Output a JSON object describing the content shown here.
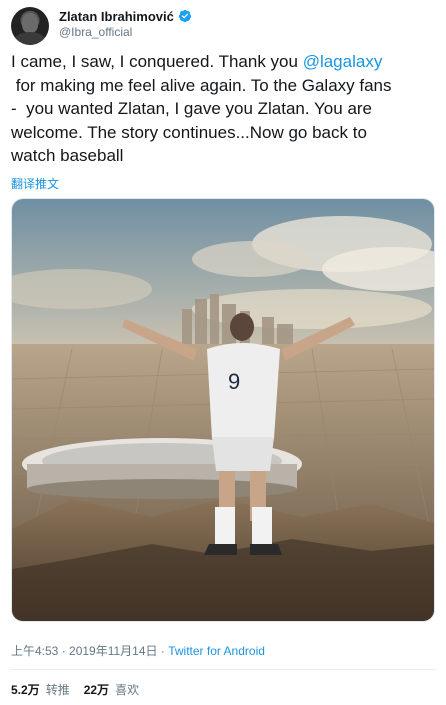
{
  "author": {
    "display_name": "Zlatan Ibrahimović",
    "handle": "@Ibra_official"
  },
  "tweet": {
    "text_before_mention": "I came, I saw, I conquered. Thank you ",
    "mention": "@lagalaxy",
    "text_after_mention": "\n for making me feel alive again. To the Galaxy fans\n-  you wanted Zlatan, I gave you Zlatan. You are\nwelcome. The story continues...Now go back to\nwatch baseball"
  },
  "translate_label": "翻译推文",
  "meta": {
    "timestamp": "上午4:53 · 2019年11月14日",
    "separator": " · ",
    "source": "Twitter for Android"
  },
  "stats": {
    "retweets_count": "5.2万",
    "retweets_label": "转推",
    "likes_count": "22万",
    "likes_label": "喜欢"
  },
  "colors": {
    "link": "#1b95e0",
    "secondary_text": "#657786",
    "verified_badge": "#1da1f2"
  },
  "icons": [
    "verified-badge-icon"
  ]
}
